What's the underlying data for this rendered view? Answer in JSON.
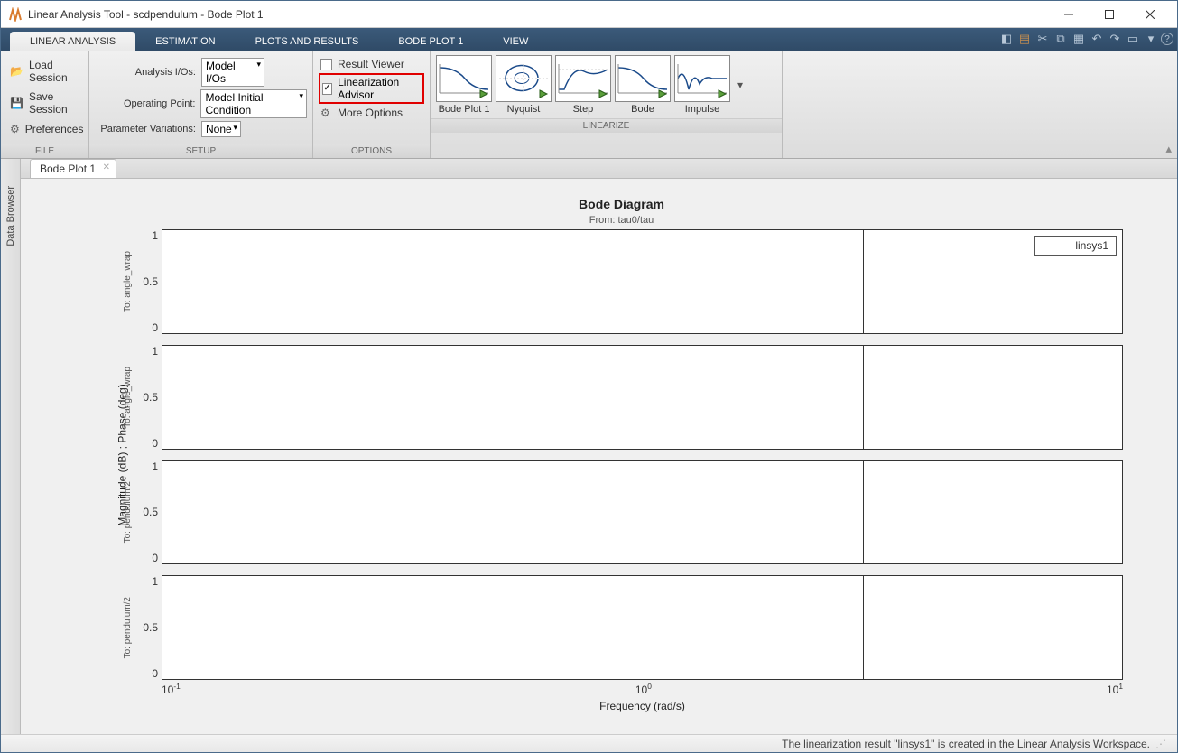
{
  "window": {
    "title": "Linear Analysis Tool - scdpendulum - Bode Plot 1"
  },
  "tabs": {
    "items": [
      {
        "label": "LINEAR ANALYSIS",
        "active": true
      },
      {
        "label": "ESTIMATION"
      },
      {
        "label": "PLOTS AND RESULTS"
      },
      {
        "label": "BODE PLOT 1"
      },
      {
        "label": "VIEW"
      }
    ]
  },
  "ribbon": {
    "file": {
      "label": "FILE",
      "load": "Load Session",
      "save": "Save Session",
      "prefs": "Preferences"
    },
    "setup": {
      "label": "SETUP",
      "io_label": "Analysis I/Os:",
      "io_value": "Model I/Os",
      "op_label": "Operating Point:",
      "op_value": "Model Initial Condition",
      "pv_label": "Parameter Variations:",
      "pv_value": "None"
    },
    "options": {
      "label": "OPTIONS",
      "result_viewer": "Result Viewer",
      "lin_advisor": "Linearization Advisor",
      "more": "More Options"
    },
    "linearize": {
      "label": "LINEARIZE",
      "thumbs": [
        {
          "label": "Bode Plot 1"
        },
        {
          "label": "Nyquist"
        },
        {
          "label": "Step"
        },
        {
          "label": "Bode"
        },
        {
          "label": "Impulse"
        }
      ]
    }
  },
  "sidebar": {
    "label": "Data Browser"
  },
  "doc_tab": {
    "label": "Bode Plot 1"
  },
  "plot": {
    "title": "Bode Diagram",
    "subtitle": "From: tau0/tau",
    "ylabel": "Magnitude (dB) ; Phase (deg)",
    "xlabel": "Frequency  (rad/s)",
    "legend": "linsys1",
    "rows": [
      {
        "label": "To: angle_wrap"
      },
      {
        "label": "To: angle_wrap"
      },
      {
        "label": "To: pendulum/2"
      },
      {
        "label": "To: pendulum/2"
      }
    ],
    "yticks": [
      "1",
      "0.5",
      "0"
    ]
  },
  "status": {
    "message": "The linearization result \"linsys1\" is created in the Linear Analysis Workspace."
  },
  "chart_data": {
    "type": "line",
    "title": "Bode Diagram",
    "subtitle": "From: tau0/tau",
    "xlabel": "Frequency (rad/s)",
    "ylabel": "Magnitude (dB) ; Phase (deg)",
    "xscale": "log",
    "xlim": [
      0.1,
      10
    ],
    "ylim": [
      0,
      1
    ],
    "legend": [
      "linsys1"
    ],
    "subplots": [
      {
        "to": "angle_wrap",
        "kind": "magnitude",
        "series": [
          {
            "name": "linsys1",
            "x": [],
            "y": []
          }
        ]
      },
      {
        "to": "angle_wrap",
        "kind": "phase",
        "series": [
          {
            "name": "linsys1",
            "x": [],
            "y": []
          }
        ]
      },
      {
        "to": "pendulum/2",
        "kind": "magnitude",
        "series": [
          {
            "name": "linsys1",
            "x": [],
            "y": []
          }
        ]
      },
      {
        "to": "pendulum/2",
        "kind": "phase",
        "series": [
          {
            "name": "linsys1",
            "x": [],
            "y": []
          }
        ]
      }
    ]
  }
}
